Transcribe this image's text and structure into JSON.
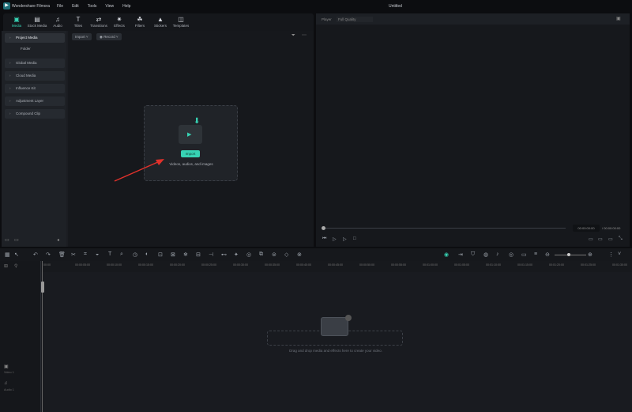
{
  "app": {
    "name": "Wondershare Filmora",
    "window_title": "Untitled",
    "menu": [
      "File",
      "Edit",
      "Tools",
      "View",
      "Help"
    ]
  },
  "tabs": [
    {
      "label": "Media",
      "icon": "media-icon",
      "active": true
    },
    {
      "label": "Stock Media",
      "icon": "stock-media-icon"
    },
    {
      "label": "Audio",
      "icon": "music-note-icon"
    },
    {
      "label": "Titles",
      "icon": "text-icon"
    },
    {
      "label": "Transitions",
      "icon": "transitions-icon"
    },
    {
      "label": "Effects",
      "icon": "effects-icon"
    },
    {
      "label": "Filters",
      "icon": "filters-icon"
    },
    {
      "label": "Stickers",
      "icon": "stickers-icon"
    },
    {
      "label": "Templates",
      "icon": "templates-icon"
    }
  ],
  "sidebar": {
    "items": [
      {
        "label": "Project Media",
        "open": true
      },
      {
        "label": "Global Media"
      },
      {
        "label": "Cloud Media"
      },
      {
        "label": "Influence Kit"
      },
      {
        "label": "Adjustment Layer"
      },
      {
        "label": "Compound Clip"
      }
    ],
    "folder": "Folder"
  },
  "media": {
    "import_label": "Import",
    "record_label": "Record",
    "import_button": "Import",
    "hint": "Videos, audios, and images"
  },
  "player": {
    "label": "Player",
    "quality": "Full Quality",
    "current_time": "00:00:00:00",
    "total_time": "00:00:00:00"
  },
  "timeline": {
    "ruler": [
      "00:00",
      "00:00:05:00",
      "00:00:10:00",
      "00:00:15:00",
      "00:00:20:00",
      "00:00:25:00",
      "00:00:30:00",
      "00:00:35:00",
      "00:00:40:00",
      "00:00:45:00",
      "00:00:50:00",
      "00:00:55:00",
      "00:01:00:00",
      "00:01:05:00",
      "00:01:10:00",
      "00:01:15:00",
      "00:01:20:00",
      "00:01:25:00",
      "00:01:30:00"
    ],
    "drop_hint": "Drag and drop media and effects here to create your video.",
    "tracks": [
      {
        "label": "Video 1"
      },
      {
        "label": "Audio 1"
      }
    ]
  },
  "colors": {
    "accent": "#37d3b4",
    "annotation_arrow": "#e0312b"
  }
}
